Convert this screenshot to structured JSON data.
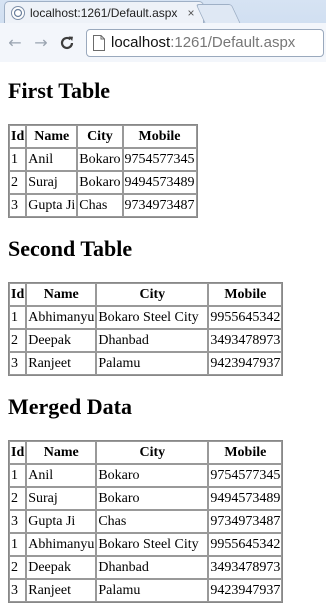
{
  "browser": {
    "tab_title": "localhost:1261/Default.aspx",
    "tab_close": "×",
    "url_host": "localhost",
    "url_rest": ":1261/Default.aspx",
    "back_glyph": "←",
    "forward_glyph": "→",
    "reload_glyph": "C"
  },
  "sections": {
    "first": {
      "heading": "First Table",
      "headers": [
        "Id",
        "Name",
        "City",
        "Mobile"
      ],
      "rows": [
        [
          "1",
          "Anil",
          "Bokaro",
          "9754577345"
        ],
        [
          "2",
          "Suraj",
          "Bokaro",
          "9494573489"
        ],
        [
          "3",
          "Gupta Ji",
          "Chas",
          "9734973487"
        ]
      ]
    },
    "second": {
      "heading": "Second Table",
      "headers": [
        "Id",
        "Name",
        "City",
        "Mobile"
      ],
      "rows": [
        [
          "1",
          "Abhimanyu",
          "Bokaro Steel City",
          "9955645342"
        ],
        [
          "2",
          "Deepak",
          "Dhanbad",
          "3493478973"
        ],
        [
          "3",
          "Ranjeet",
          "Palamu",
          "9423947937"
        ]
      ]
    },
    "merged": {
      "heading": "Merged Data",
      "headers": [
        "Id",
        "Name",
        "City",
        "Mobile"
      ],
      "rows": [
        [
          "1",
          "Anil",
          "Bokaro",
          "9754577345"
        ],
        [
          "2",
          "Suraj",
          "Bokaro",
          "9494573489"
        ],
        [
          "3",
          "Gupta Ji",
          "Chas",
          "9734973487"
        ],
        [
          "1",
          "Abhimanyu",
          "Bokaro Steel City",
          "9955645342"
        ],
        [
          "2",
          "Deepak",
          "Dhanbad",
          "3493478973"
        ],
        [
          "3",
          "Ranjeet",
          "Palamu",
          "9423947937"
        ]
      ]
    }
  }
}
